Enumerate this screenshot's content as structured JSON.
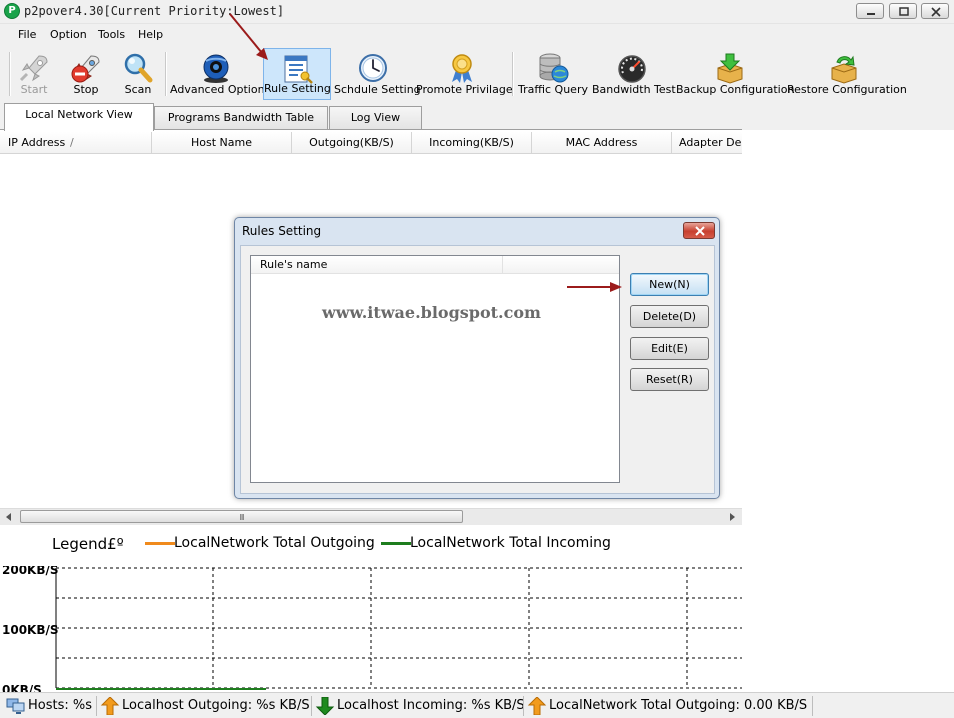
{
  "window": {
    "title": "p2pover4.30[Current Priority:Lowest]",
    "app_icon_glyph": "P"
  },
  "menu": [
    "File",
    "Option",
    "Tools",
    "Help"
  ],
  "toolbar": {
    "buttons": [
      {
        "id": "start",
        "label": "Start",
        "icon": "rocket-icon"
      },
      {
        "id": "stop",
        "label": "Stop",
        "icon": "stop-rocket-icon"
      },
      {
        "id": "scan",
        "label": "Scan",
        "icon": "magnifier-icon"
      },
      {
        "id": "advanced",
        "label": "Advanced Option",
        "icon": "webcam-globe-icon"
      },
      {
        "id": "rule",
        "label": "Rule Setting",
        "icon": "rule-sheet-icon"
      },
      {
        "id": "schedule",
        "label": "Schdule Setting",
        "icon": "clock-icon"
      },
      {
        "id": "promote",
        "label": "Promote Privilage",
        "icon": "award-ribbon-icon"
      },
      {
        "id": "traffic",
        "label": "Traffic Query",
        "icon": "database-globe-icon"
      },
      {
        "id": "bandwidth",
        "label": "Bandwidth Test",
        "icon": "speedometer-icon"
      },
      {
        "id": "backup",
        "label": "Backup Configuration",
        "icon": "box-down-arrow-icon"
      },
      {
        "id": "restore",
        "label": "Restore Configuration",
        "icon": "box-recycle-icon"
      }
    ]
  },
  "tabs": [
    "Local Network View",
    "Programs Bandwidth Table",
    "Log View"
  ],
  "list_columns": [
    "IP Address",
    "Host Name",
    "Outgoing(KB/S)",
    "Incoming(KB/S)",
    "MAC Address",
    "Adapter Desc"
  ],
  "sort_indicator": "/",
  "scroll_grip": "III",
  "legend": {
    "title": "Legend£º",
    "items": [
      {
        "label": "LocalNetwork Total Outgoing",
        "color": "#f08a1c"
      },
      {
        "label": "LocalNetwork Total Incoming",
        "color": "#1e7d1e"
      }
    ]
  },
  "chart_data": {
    "type": "line",
    "y_tick_labels": [
      "200KB/S",
      "100KB/S",
      "0KB/S"
    ],
    "ylim": [
      0,
      200
    ],
    "grid": true,
    "series": [
      {
        "name": "LocalNetwork Total Outgoing",
        "values": []
      },
      {
        "name": "LocalNetwork Total Incoming",
        "values": []
      }
    ]
  },
  "status": {
    "hosts": "Hosts: %s",
    "localhost_out": "Localhost Outgoing: %s KB/S",
    "localhost_in": "Localhost Incoming: %s KB/S",
    "network_out": "LocalNetwork Total Outgoing: 0.00 KB/S"
  },
  "dialog": {
    "title": "Rules Setting",
    "column": "Rule's name",
    "watermark": "www.itwae.blogspot.com",
    "buttons": [
      "New(N)",
      "Delete(D)",
      "Edit(E)",
      "Reset(R)"
    ]
  },
  "colors": {
    "annotation_arrow": "#9b1b1b",
    "active_tool": "#cde6fb"
  }
}
